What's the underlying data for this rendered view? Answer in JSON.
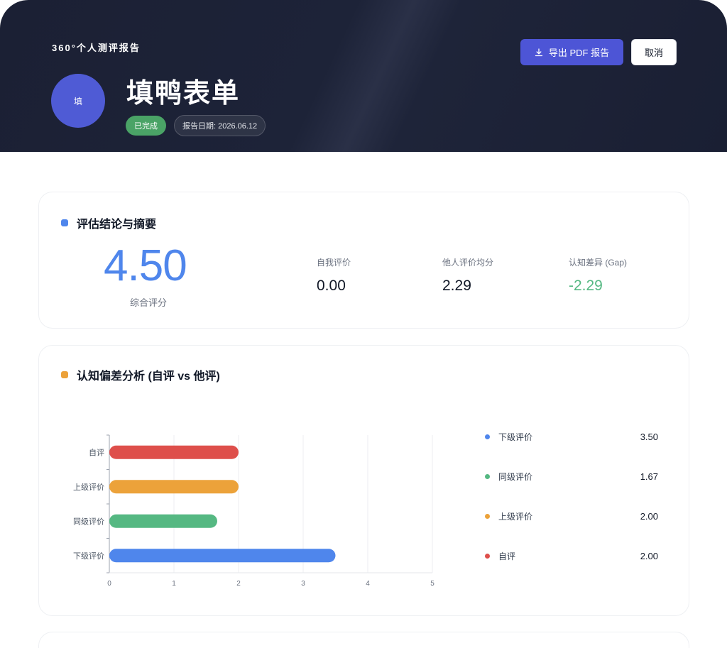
{
  "header": {
    "eyebrow": "360°个人测评报告",
    "avatar_text": "填",
    "name": "填鸭表单",
    "status": "已完成",
    "report_date": "报告日期: 2026.06.12",
    "export_label": "导出 PDF 报告",
    "cancel_label": "取消"
  },
  "summary": {
    "title": "评估结论与摘要",
    "accent": "#4f86ec",
    "overall_score": "4.50",
    "overall_label": "综合评分",
    "metrics": [
      {
        "label": "自我评价",
        "value": "0.00",
        "color": "#111827"
      },
      {
        "label": "他人评价均分",
        "value": "2.29",
        "color": "#111827"
      },
      {
        "label": "认知差异 (Gap)",
        "value": "-2.29",
        "color": "#55b882"
      }
    ]
  },
  "bias": {
    "title": "认知偏差分析 (自评 vs 他评)",
    "accent": "#eca23a",
    "legend": [
      {
        "name": "下级评价",
        "value": "3.50",
        "color": "#4f86ec"
      },
      {
        "name": "同级评价",
        "value": "1.67",
        "color": "#55b882"
      },
      {
        "name": "上级评价",
        "value": "2.00",
        "color": "#eca23a"
      },
      {
        "name": "自评",
        "value": "2.00",
        "color": "#de4f4b"
      }
    ]
  },
  "chart_data": {
    "type": "bar",
    "orientation": "horizontal",
    "categories": [
      "自评",
      "上级评价",
      "同级评价",
      "下级评价"
    ],
    "values": [
      2.0,
      2.0,
      1.67,
      3.5
    ],
    "colors": [
      "#de4f4b",
      "#eca23a",
      "#55b882",
      "#4f86ec"
    ],
    "xlim": [
      0,
      5
    ],
    "xticks": [
      "0",
      "1",
      "2",
      "3",
      "4",
      "5"
    ],
    "grid": true
  }
}
